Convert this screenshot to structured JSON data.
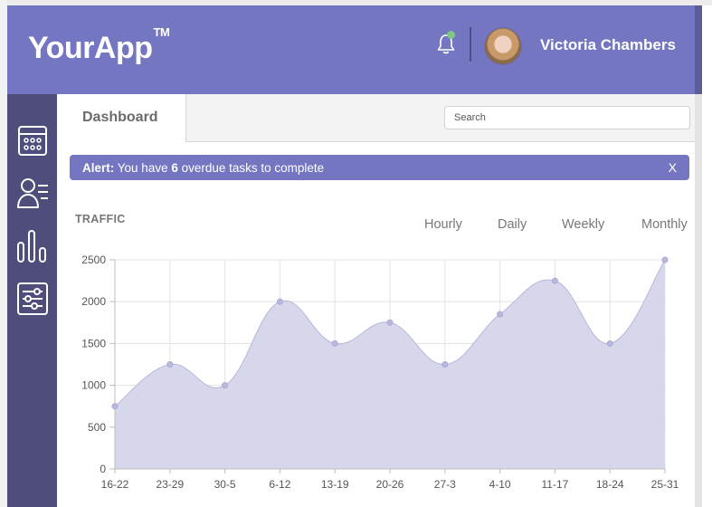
{
  "app": {
    "logo": "YourApp",
    "logo_mark": "TM"
  },
  "header": {
    "notification_icon": "bell-icon",
    "notification_dot_color": "#81c784",
    "user_name": "Victoria Chambers"
  },
  "sidebar": {
    "items": [
      {
        "icon": "calendar-icon"
      },
      {
        "icon": "users-list-icon"
      },
      {
        "icon": "bar-chart-icon"
      },
      {
        "icon": "sliders-icon"
      }
    ]
  },
  "tabs": {
    "active": "Dashboard"
  },
  "search": {
    "placeholder": "Search"
  },
  "alert": {
    "label": "Alert:",
    "text_before": " You have ",
    "count": "6",
    "text_after": " overdue tasks to complete",
    "close": "X"
  },
  "traffic": {
    "title": "TRAFFIC",
    "periods": [
      "Hourly",
      "Daily",
      "Weekly",
      "Monthly"
    ]
  },
  "colors": {
    "header": "#7476c2",
    "sidebar": "#4e4d7b",
    "chart_fill": "#d5d5ea",
    "chart_line": "#b6b6dc"
  },
  "chart_data": {
    "type": "area",
    "categories": [
      "16-22",
      "23-29",
      "30-5",
      "6-12",
      "13-19",
      "20-26",
      "27-3",
      "4-10",
      "11-17",
      "18-24",
      "25-31"
    ],
    "values": [
      750,
      1250,
      1000,
      2000,
      1500,
      1750,
      1250,
      1850,
      2250,
      1500,
      2500
    ],
    "yticks": [
      0,
      500,
      1000,
      1500,
      2000,
      2500
    ],
    "ylim": [
      0,
      2500
    ],
    "grid": true,
    "smooth": true
  }
}
